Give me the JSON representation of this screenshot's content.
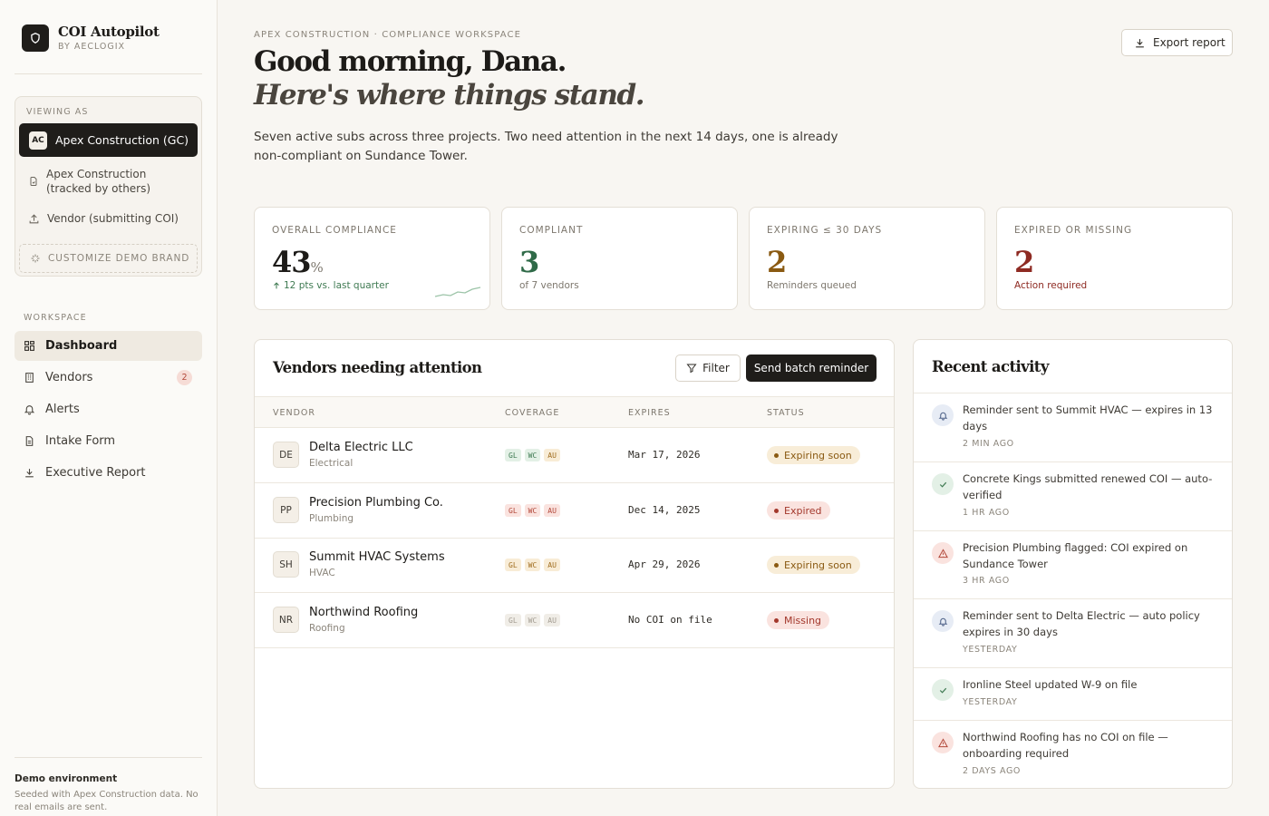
{
  "brand": {
    "name": "COI Autopilot",
    "sub": "BY AECLOGIX"
  },
  "viewing": {
    "label": "VIEWING AS",
    "active": {
      "badge": "AC",
      "label": "Apex Construction (GC)"
    },
    "options": [
      "Apex Construction (tracked by others)",
      "Vendor (submitting COI)"
    ],
    "customize": "CUSTOMIZE DEMO BRAND"
  },
  "nav": {
    "section": "WORKSPACE",
    "items": [
      {
        "label": "Dashboard",
        "icon": "dashboard-icon"
      },
      {
        "label": "Vendors",
        "icon": "building-icon",
        "badge": "2"
      },
      {
        "label": "Alerts",
        "icon": "bell-icon"
      },
      {
        "label": "Intake Form",
        "icon": "document-icon"
      },
      {
        "label": "Executive Report",
        "icon": "download-icon"
      }
    ]
  },
  "demo": {
    "title": "Demo environment",
    "text": "Seeded with Apex Construction data. No real emails are sent."
  },
  "header": {
    "eyebrow": "APEX CONSTRUCTION · COMPLIANCE WORKSPACE",
    "greeting": "Good morning, Dana.",
    "subheading": "Here's where things stand.",
    "intro": "Seven active subs across three projects. Two need attention in the next 14 days, one is already non-compliant on Sundance Tower.",
    "export": "Export report"
  },
  "stats": [
    {
      "label": "OVERALL COMPLIANCE",
      "value": "43",
      "unit": "%",
      "sub": "12 pts vs. last quarter",
      "color": "#1d1b18",
      "subColor": "#3f7a52"
    },
    {
      "label": "COMPLIANT",
      "value": "3",
      "sub": "of 7 vendors",
      "color": "#2f6a48",
      "subColor": "#7d776d"
    },
    {
      "label": "EXPIRING ≤ 30 DAYS",
      "value": "2",
      "sub": "Reminders queued",
      "color": "#8a5a12",
      "subColor": "#7d776d"
    },
    {
      "label": "EXPIRED OR MISSING",
      "value": "2",
      "sub": "Action required",
      "color": "#8e2a22",
      "subColor": "#8e2a22"
    }
  ],
  "vendors": {
    "title": "Vendors needing attention",
    "filter": "Filter",
    "batch": "Send batch reminder",
    "columns": [
      "VENDOR",
      "COVERAGE",
      "EXPIRES",
      "STATUS"
    ],
    "rows": [
      {
        "initials": "DE",
        "name": "Delta Electric LLC",
        "category": "Electrical",
        "coverage": [
          {
            "code": "GL",
            "state": "green"
          },
          {
            "code": "WC",
            "state": "green"
          },
          {
            "code": "AU",
            "state": "amber"
          }
        ],
        "expires": "Mar 17, 2026",
        "status": "Expiring soon",
        "statusType": "expiring"
      },
      {
        "initials": "PP",
        "name": "Precision Plumbing Co.",
        "category": "Plumbing",
        "coverage": [
          {
            "code": "GL",
            "state": "red"
          },
          {
            "code": "WC",
            "state": "red"
          },
          {
            "code": "AU",
            "state": "red"
          }
        ],
        "expires": "Dec 14, 2025",
        "status": "Expired",
        "statusType": "expired"
      },
      {
        "initials": "SH",
        "name": "Summit HVAC Systems",
        "category": "HVAC",
        "coverage": [
          {
            "code": "GL",
            "state": "amber"
          },
          {
            "code": "WC",
            "state": "amber"
          },
          {
            "code": "AU",
            "state": "amber"
          }
        ],
        "expires": "Apr 29, 2026",
        "status": "Expiring soon",
        "statusType": "expiring"
      },
      {
        "initials": "NR",
        "name": "Northwind Roofing",
        "category": "Roofing",
        "coverage": [
          {
            "code": "GL",
            "state": "gray"
          },
          {
            "code": "WC",
            "state": "gray"
          },
          {
            "code": "AU",
            "state": "gray"
          }
        ],
        "expires": "No COI on file",
        "status": "Missing",
        "statusType": "missing"
      }
    ]
  },
  "activity": {
    "title": "Recent activity",
    "items": [
      {
        "type": "bell",
        "text": "Reminder sent to Summit HVAC — expires in 13 days",
        "time": "2 MIN AGO"
      },
      {
        "type": "check",
        "text": "Concrete Kings submitted renewed COI — auto-verified",
        "time": "1 HR AGO"
      },
      {
        "type": "warn",
        "text": "Precision Plumbing flagged: COI expired on Sundance Tower",
        "time": "3 HR AGO"
      },
      {
        "type": "bell",
        "text": "Reminder sent to Delta Electric — auto policy expires in 30 days",
        "time": "YESTERDAY"
      },
      {
        "type": "check",
        "text": "Ironline Steel updated W-9 on file",
        "time": "YESTERDAY"
      },
      {
        "type": "warn",
        "text": "Northwind Roofing has no COI on file — onboarding required",
        "time": "2 DAYS AGO"
      }
    ]
  }
}
